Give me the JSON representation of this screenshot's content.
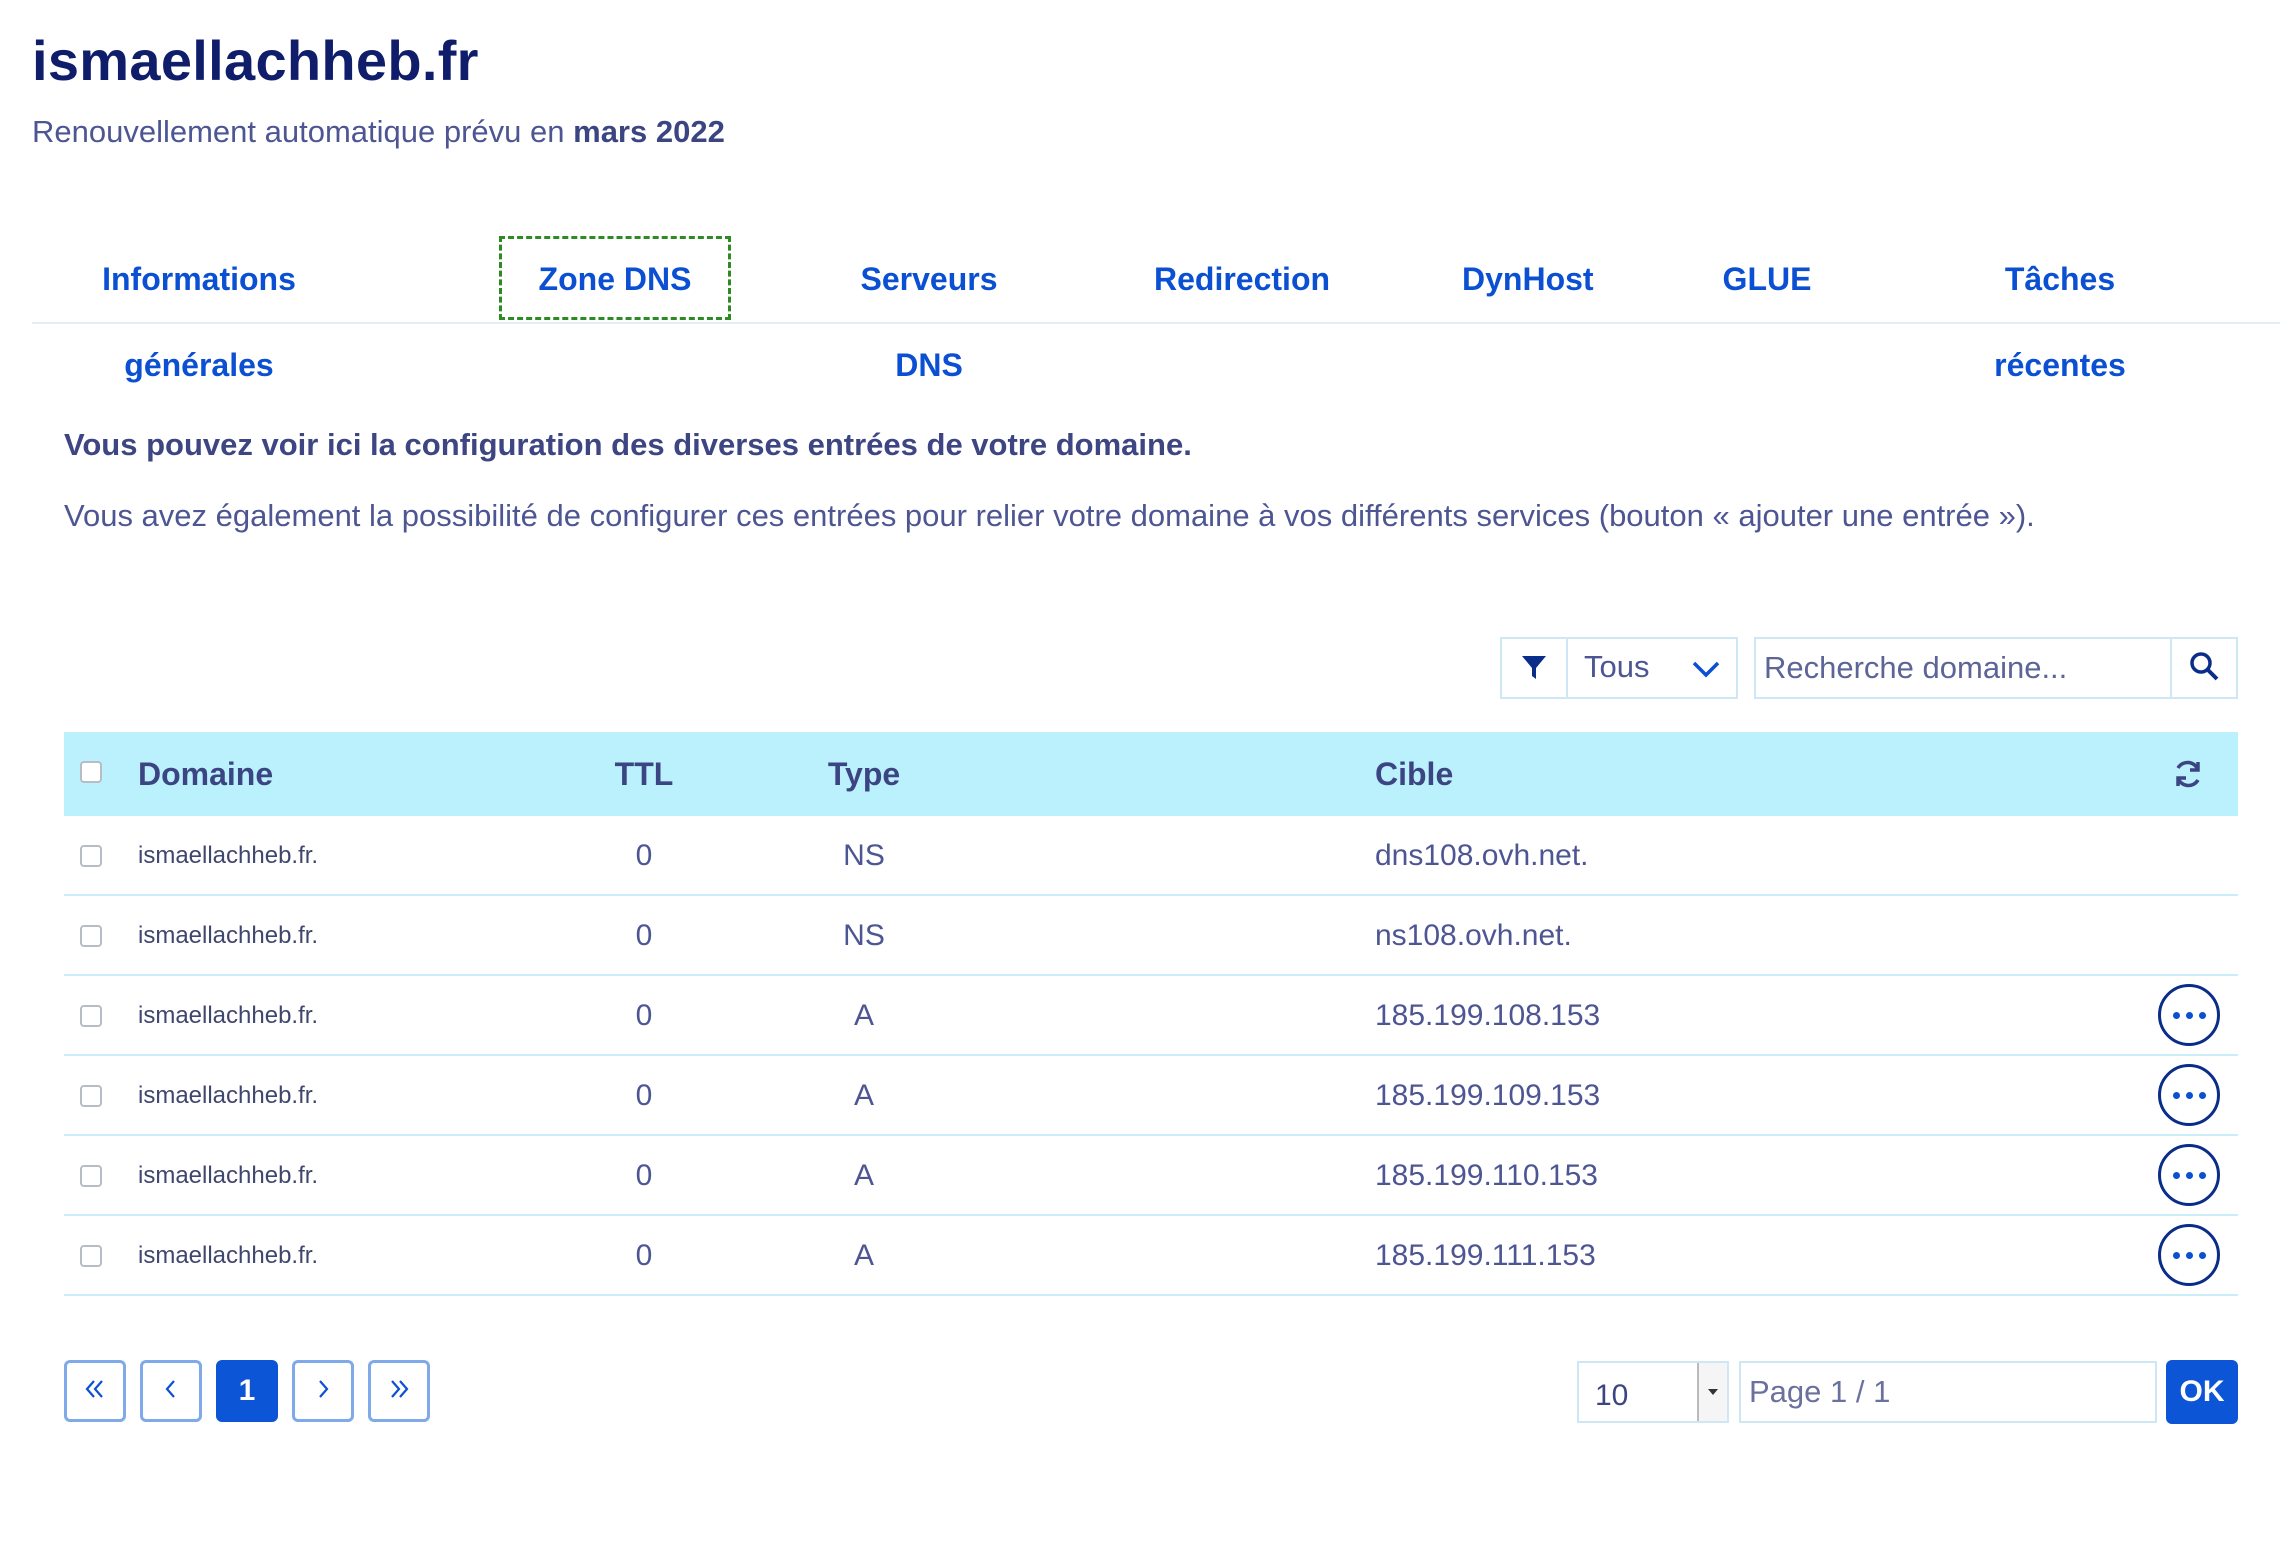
{
  "header": {
    "title": "ismaellachheb.fr",
    "renewal_prefix": "Renouvellement automatique prévu en ",
    "renewal_date": "mars 2022"
  },
  "tabs": [
    {
      "label": "Informations générales",
      "active": false
    },
    {
      "label": "Zone DNS",
      "active": true
    },
    {
      "label": "Serveurs DNS",
      "active": false
    },
    {
      "label": "Redirection",
      "active": false
    },
    {
      "label": "DynHost",
      "active": false
    },
    {
      "label": "GLUE",
      "active": false
    },
    {
      "label": "Tâches récentes",
      "active": false
    }
  ],
  "intro": {
    "line1": "Vous pouvez voir ici la configuration des diverses entrées de votre domaine.",
    "line2": "Vous avez également la possibilité de configurer ces entrées pour relier votre domaine à vos différents services (bouton « ajouter une entrée »)."
  },
  "filter": {
    "icon": "filter-icon",
    "selected": "Tous"
  },
  "search": {
    "placeholder": "Recherche domaine...",
    "icon": "search-icon"
  },
  "table": {
    "columns": {
      "domain": "Domaine",
      "ttl": "TTL",
      "type": "Type",
      "target": "Cible"
    },
    "rows": [
      {
        "domain": "ismaellachheb.fr.",
        "ttl": "0",
        "type": "NS",
        "target": "dns108.ovh.net.",
        "has_actions": false
      },
      {
        "domain": "ismaellachheb.fr.",
        "ttl": "0",
        "type": "NS",
        "target": "ns108.ovh.net.",
        "has_actions": false
      },
      {
        "domain": "ismaellachheb.fr.",
        "ttl": "0",
        "type": "A",
        "target": "185.199.108.153",
        "has_actions": true
      },
      {
        "domain": "ismaellachheb.fr.",
        "ttl": "0",
        "type": "A",
        "target": "185.199.109.153",
        "has_actions": true
      },
      {
        "domain": "ismaellachheb.fr.",
        "ttl": "0",
        "type": "A",
        "target": "185.199.110.153",
        "has_actions": true
      },
      {
        "domain": "ismaellachheb.fr.",
        "ttl": "0",
        "type": "A",
        "target": "185.199.111.153",
        "has_actions": true
      }
    ]
  },
  "pagination": {
    "current_page": "1",
    "per_page": "10",
    "page_placeholder": "Page 1 / 1",
    "ok_label": "OK"
  },
  "colors": {
    "accent": "#0b55d6",
    "title": "#0f1d6b",
    "header_row": "#bbf0fd",
    "text": "#4d5693"
  }
}
